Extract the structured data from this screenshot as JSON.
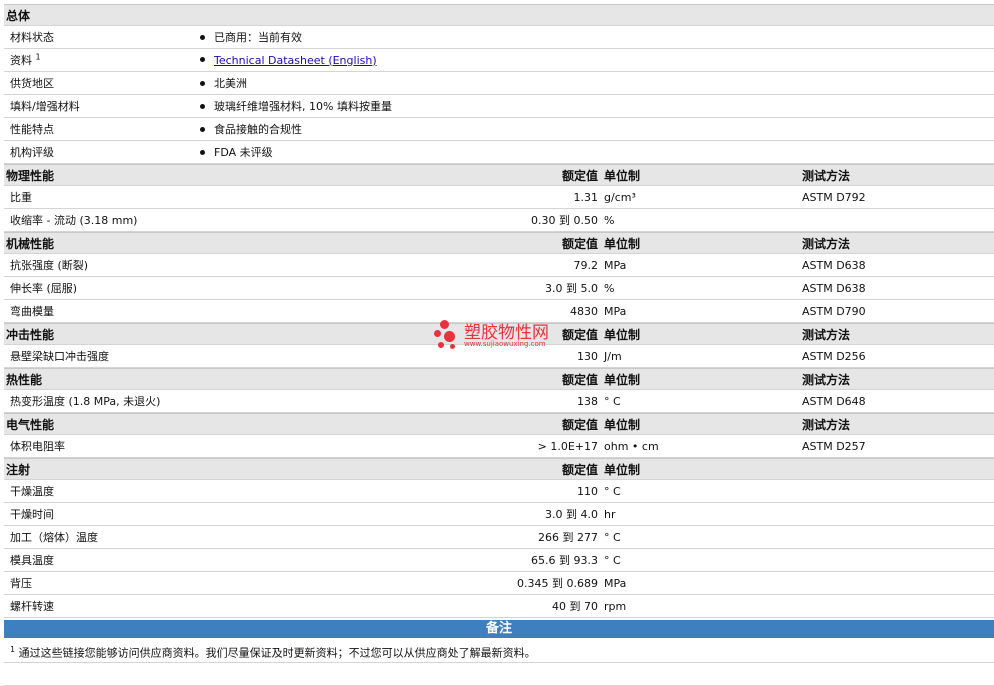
{
  "general": {
    "title": "总体",
    "rows": [
      {
        "label": "材料状态",
        "value": "已商用：当前有效"
      },
      {
        "label": "资料",
        "sup": "1",
        "link": "Technical Datasheet (English)"
      },
      {
        "label": "供货地区",
        "value": "北美洲"
      },
      {
        "label": "填料/增强材料",
        "value": "玻璃纤维增强材料, 10% 填料按重量"
      },
      {
        "label": "性能特点",
        "value": "食品接触的合规性"
      },
      {
        "label": "机构评级",
        "value": "FDA 未评级"
      }
    ]
  },
  "headers": {
    "value": "额定值",
    "unit": "单位制",
    "test": "测试方法"
  },
  "sections": [
    {
      "title": "物理性能",
      "show_test": true,
      "rows": [
        {
          "label": "比重",
          "value": "1.31",
          "unit": "g/cm³",
          "test": "ASTM D792"
        },
        {
          "label": "收缩率 - 流动 (3.18 mm)",
          "value": "0.30 到  0.50",
          "unit": "%",
          "test": ""
        }
      ]
    },
    {
      "title": "机械性能",
      "show_test": true,
      "rows": [
        {
          "label": "抗张强度 (断裂)",
          "value": "79.2",
          "unit": "MPa",
          "test": "ASTM D638"
        },
        {
          "label": "伸长率 (屈服)",
          "value": "3.0 到  5.0",
          "unit": "%",
          "test": "ASTM D638"
        },
        {
          "label": "弯曲模量",
          "value": "4830",
          "unit": "MPa",
          "test": "ASTM D790"
        }
      ]
    },
    {
      "title": "冲击性能",
      "show_test": true,
      "rows": [
        {
          "label": "悬壁梁缺口冲击强度",
          "value": "130",
          "unit": "J/m",
          "test": "ASTM D256"
        }
      ]
    },
    {
      "title": "热性能",
      "show_test": true,
      "rows": [
        {
          "label": "热变形温度 (1.8 MPa, 未退火)",
          "value": "138",
          "unit": "° C",
          "test": "ASTM D648"
        }
      ]
    },
    {
      "title": "电气性能",
      "show_test": true,
      "rows": [
        {
          "label": "体积电阻率",
          "value": "> 1.0E+17",
          "unit": "ohm • cm",
          "test": "ASTM D257"
        }
      ]
    },
    {
      "title": "注射",
      "show_test": false,
      "rows": [
        {
          "label": "干燥温度",
          "value": "110",
          "unit": "° C",
          "test": ""
        },
        {
          "label": "干燥时间",
          "value": "3.0 到  4.0",
          "unit": "hr",
          "test": ""
        },
        {
          "label": "加工（熔体）温度",
          "value": "266 到  277",
          "unit": "° C",
          "test": ""
        },
        {
          "label": "模具温度",
          "value": "65.6 到  93.3",
          "unit": "° C",
          "test": ""
        },
        {
          "label": "背压",
          "value": "0.345 到  0.689",
          "unit": "MPa",
          "test": ""
        },
        {
          "label": "螺杆转速",
          "value": "40 到  70",
          "unit": "rpm",
          "test": ""
        }
      ]
    }
  ],
  "notes": {
    "title": "备注",
    "sup": "1",
    "text": "通过这些链接您能够访问供应商资料。我们尽量保证及时更新资料；不过您可以从供应商处了解最新资料。"
  },
  "watermark": {
    "title": "塑胶物性网",
    "url": "www.sujiaowuxing.com"
  },
  "colors": {
    "section_bg": "#e6e6e6",
    "notes_bar": "#3d7fbf",
    "watermark": "#e8323c",
    "link": "#1a0dab"
  }
}
